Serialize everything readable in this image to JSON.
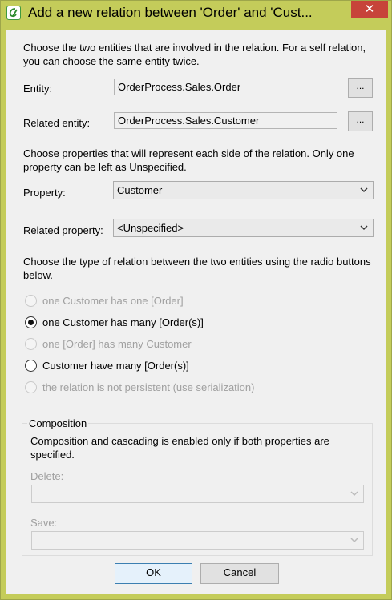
{
  "window": {
    "title": "Add a new relation between 'Order' and 'Cust...",
    "close_glyph": "✕"
  },
  "intro_text": "Choose the two entities that are involved in the relation. For a self relation, you can choose the same entity twice.",
  "entity": {
    "label": "Entity:",
    "value": "OrderProcess.Sales.Order",
    "browse_label": "..."
  },
  "related_entity": {
    "label": "Related entity:",
    "value": "OrderProcess.Sales.Customer",
    "browse_label": "..."
  },
  "properties_text": "Choose properties that will represent each side of the relation. Only one property can be left as Unspecified.",
  "property": {
    "label": "Property:",
    "value": "Customer"
  },
  "related_property": {
    "label": "Related property:",
    "value": "<Unspecified>"
  },
  "relation_type_text": "Choose the type of relation between the two entities using the radio buttons below.",
  "relation_types": [
    {
      "label": "one Customer has one [Order]",
      "enabled": false,
      "checked": false
    },
    {
      "label": "one Customer has many [Order(s)]",
      "enabled": true,
      "checked": true
    },
    {
      "label": "one [Order] has many Customer",
      "enabled": false,
      "checked": false
    },
    {
      "label": "Customer have many [Order(s)]",
      "enabled": true,
      "checked": false
    },
    {
      "label": "the relation is not persistent (use serialization)",
      "enabled": false,
      "checked": false
    }
  ],
  "composition": {
    "legend": "Composition",
    "text": "Composition and cascading is enabled only if both properties are specified.",
    "delete_label": "Delete:",
    "delete_value": "",
    "save_label": "Save:",
    "save_value": ""
  },
  "buttons": {
    "ok": "OK",
    "cancel": "Cancel"
  }
}
